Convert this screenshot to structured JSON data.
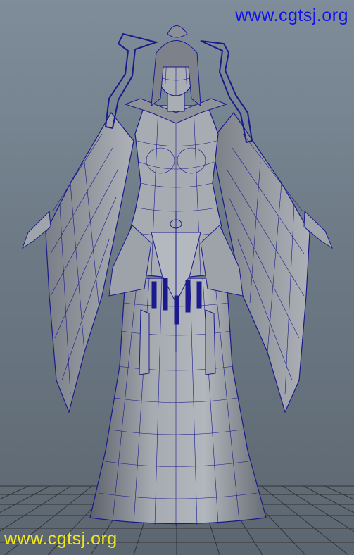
{
  "watermarks": {
    "top_right": "www.cgtsj.org",
    "bottom_left": "www.cgtsj.org"
  },
  "colors": {
    "background": "#6f7c88",
    "watermark_top": "#1010ee",
    "watermark_bottom": "#f2ea18",
    "wireframe": "#1a1a8c",
    "mesh_fill": "#9aa0a8",
    "ground_grid": "#2b2b2b"
  }
}
